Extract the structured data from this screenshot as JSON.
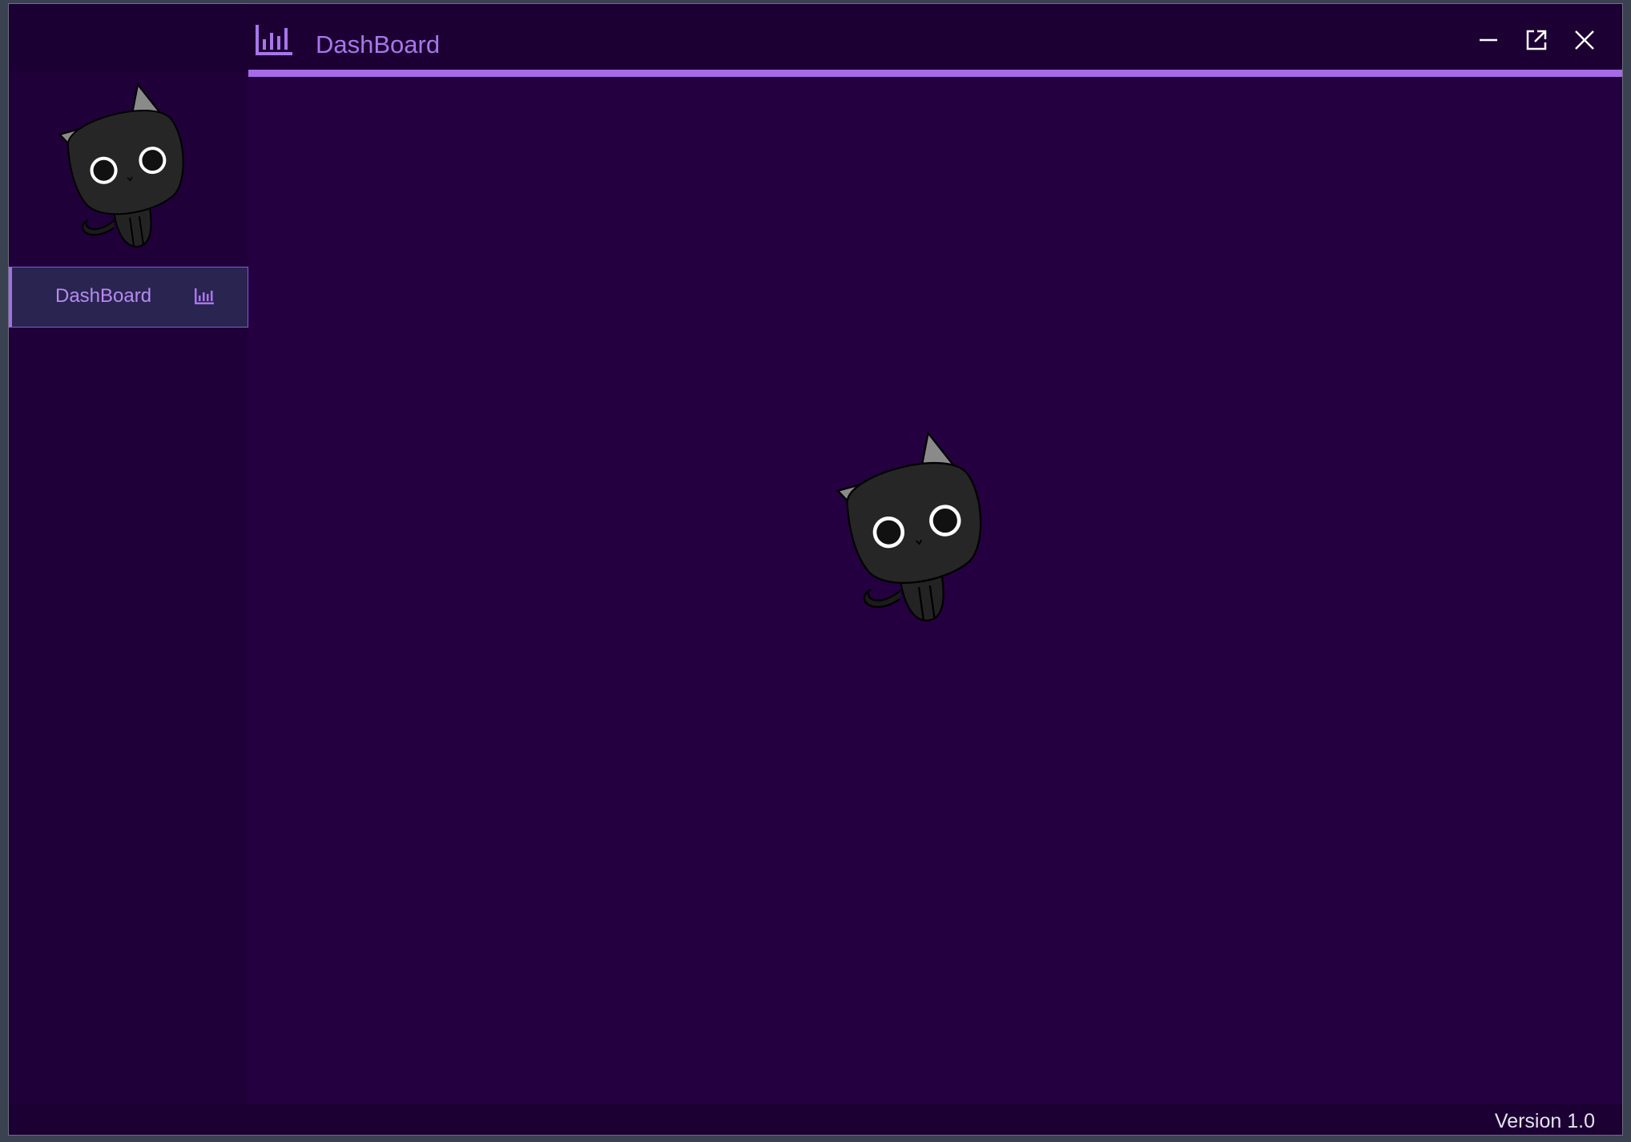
{
  "window": {
    "title": "DashBoard",
    "title_icon": "bar-chart-icon",
    "controls": {
      "minimize_icon": "minimize-icon",
      "maximize_icon": "popout-icon",
      "close_icon": "close-icon"
    }
  },
  "sidebar": {
    "logo": "black-cat-logo",
    "items": [
      {
        "label": "DashBoard",
        "icon": "bar-chart-icon",
        "active": true
      }
    ]
  },
  "main": {
    "image": "black-cat-logo"
  },
  "footer": {
    "version": "Version 1.0"
  },
  "colors": {
    "background": "#250040",
    "titlebar": "#1c0033",
    "accent": "#a66ae6",
    "nav_active_bg": "#2a2450",
    "text_accent": "#a976ea"
  }
}
